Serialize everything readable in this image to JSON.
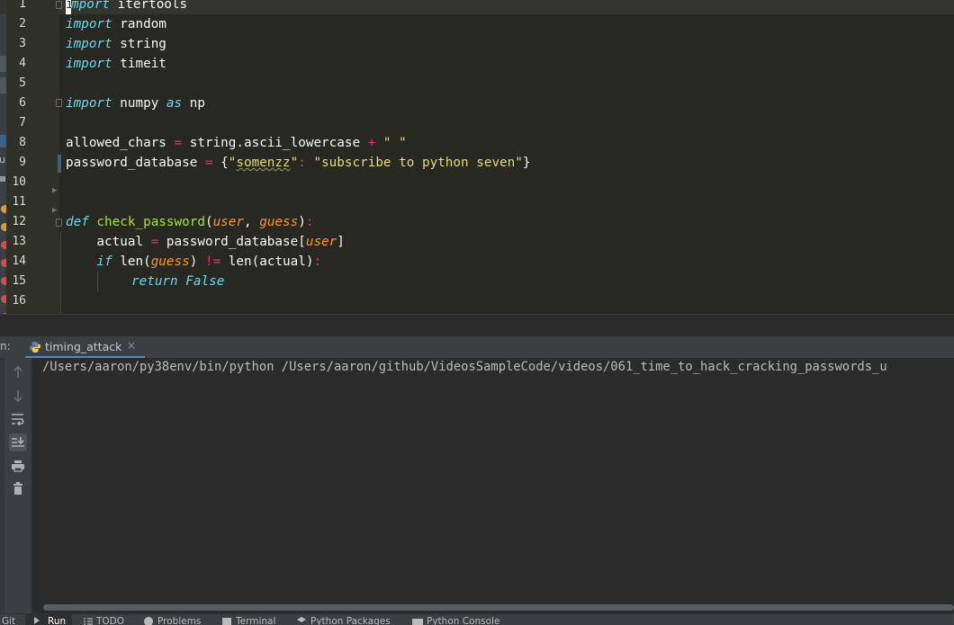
{
  "editor": {
    "line_numbers": [
      "1",
      "2",
      "3",
      "4",
      "5",
      "6",
      "7",
      "8",
      "9",
      "10",
      "11",
      "12",
      "13",
      "14",
      "15",
      "16"
    ],
    "lines": {
      "l1_kw_rest": "mport",
      "l1_mod": " itertools",
      "l2_kw": "import",
      "l2_mod": " random",
      "l3_kw": "import",
      "l3_mod": " string",
      "l4_kw": "import",
      "l4_mod": " timeit",
      "l6_kw": "import",
      "l6_mod": " numpy ",
      "l6_as": "as",
      "l6_alias": " np",
      "l8_var": "allowed_chars ",
      "l8_eq": "=",
      "l8_mid": " string.ascii_lowercase ",
      "l8_plus": "+",
      "l8_str": " \" \"",
      "l9_var": "password_database ",
      "l9_eq": "=",
      "l9_brace_open": " {",
      "l9_q1": "\"",
      "l9_key": "somenzz",
      "l9_q2": "\"",
      "l9_colon": ":",
      "l9_val": " \"subscribe to python seven\"",
      "l9_brace_close": "}",
      "l12_def": "def",
      "l12_fn": " check_password",
      "l12_p_open": "(",
      "l12_user": "user",
      "l12_comma": ", ",
      "l12_guess": "guess",
      "l12_p_close": ")",
      "l12_colon": ":",
      "l13_actual": "    actual ",
      "l13_eq": "=",
      "l13_db": " password_database[",
      "l13_user": "user",
      "l13_close": "]",
      "l14_if": "    if",
      "l14_len1": " len(",
      "l14_guess": "guess",
      "l14_close1": ") ",
      "l14_ne": "!=",
      "l14_len2": " len(actual)",
      "l14_colon": ":",
      "l15_ret": "return",
      "l15_false": " False"
    },
    "caret_char": "i",
    "left_strip_text": "u"
  },
  "run_panel": {
    "label": "n:",
    "tab_title": "timing_attack",
    "close_glyph": "×",
    "console_output": "/Users/aaron/py38env/bin/python /Users/aaron/github/VideosSampleCode/videos/061_time_to_hack_cracking_passwords_u"
  },
  "bottom_bar": {
    "git": "Git",
    "run": "Run",
    "todo": "TODO",
    "problems": "Problems",
    "terminal": "Terminal",
    "python_packages": "Python Packages",
    "python_console": "Python Console"
  },
  "colors": {
    "editor_bg": "#272822",
    "keyword": "#66d9ef",
    "string": "#e6db74",
    "operator": "#f92672",
    "function": "#a6e22e",
    "parameter": "#fd971f",
    "tab_underline": "#4a88c7"
  }
}
